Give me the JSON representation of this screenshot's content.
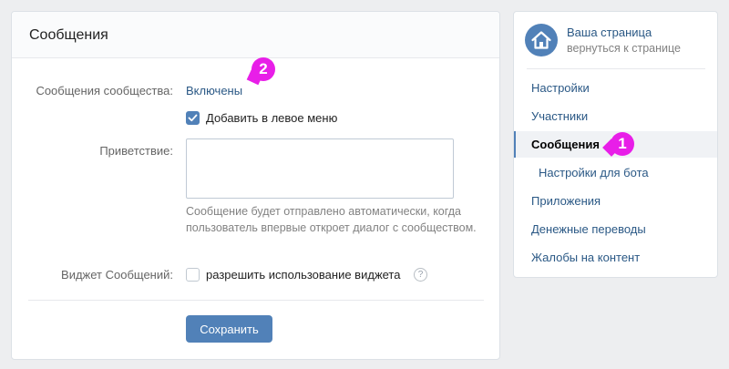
{
  "main": {
    "title": "Сообщения",
    "community_messages": {
      "label": "Сообщения сообщества:",
      "value": "Включены"
    },
    "add_to_left_menu": {
      "label": "Добавить в левое меню",
      "checked": true
    },
    "greeting": {
      "label": "Приветствие:",
      "value": "",
      "hint": "Сообщение будет отправлено автоматически, когда пользователь впервые откроет диалог с сообществом."
    },
    "widget": {
      "label": "Виджет Сообщений:",
      "checkbox_label": "разрешить использование виджета",
      "checked": false,
      "help_symbol": "?"
    },
    "save_label": "Сохранить"
  },
  "sidebar": {
    "page_title": "Ваша страница",
    "page_subtitle": "вернуться к странице",
    "items": [
      {
        "label": "Настройки",
        "active": false
      },
      {
        "label": "Участники",
        "active": false
      },
      {
        "label": "Сообщения",
        "active": true
      },
      {
        "label": "Настройки для бота",
        "active": false,
        "sub": true
      },
      {
        "label": "Приложения",
        "active": false
      },
      {
        "label": "Денежные переводы",
        "active": false
      },
      {
        "label": "Жалобы на контент",
        "active": false
      }
    ]
  },
  "markers": {
    "first": "1",
    "second": "2"
  },
  "colors": {
    "accent": "#5181b8",
    "link": "#2a5885",
    "marker": "#e81ee8",
    "background": "#edeef0"
  }
}
